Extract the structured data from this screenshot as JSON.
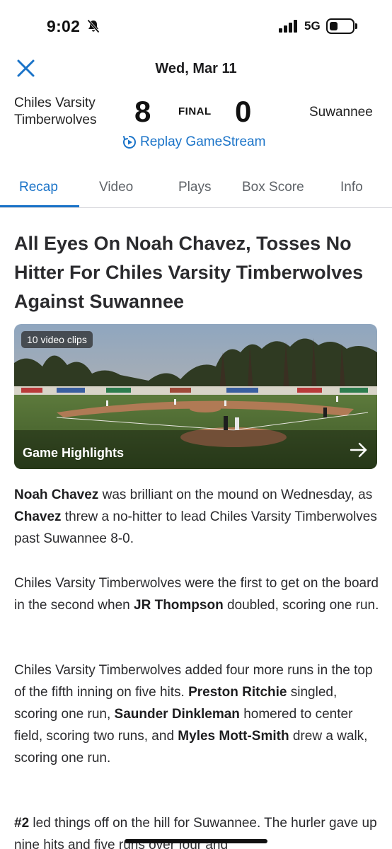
{
  "status_bar": {
    "time": "9:02",
    "network": "5G",
    "icons": [
      "bell-slash-icon",
      "signal-icon",
      "battery-icon"
    ]
  },
  "header": {
    "date": "Wed, Mar 11",
    "close_icon": "close-icon"
  },
  "scoreboard": {
    "home_team_line1": "Chiles Varsity",
    "home_team_line2": "Timberwolves",
    "home_score": "8",
    "status": "FINAL",
    "away_score": "0",
    "away_team": "Suwannee",
    "replay_label": "Replay GameStream"
  },
  "tabs": [
    {
      "label": "Recap",
      "active": true
    },
    {
      "label": "Video",
      "active": false
    },
    {
      "label": "Plays",
      "active": false
    },
    {
      "label": "Box Score",
      "active": false
    },
    {
      "label": "Info",
      "active": false
    }
  ],
  "article": {
    "headline": "All Eyes On Noah Chavez, Tosses No Hitter For Chiles Varsity Timberwolves Against Suwannee",
    "video": {
      "badge": "10 video clips",
      "title": "Game Highlights"
    },
    "paragraphs": [
      {
        "p1_a": "Noah Chavez",
        "p1_b": " was brilliant on the mound on Wednesday, as ",
        "p1_c": "Chavez",
        "p1_d": " threw a no-hitter to lead Chiles Varsity Timberwolves past Suwannee 8-0."
      },
      {
        "p2_a": "Chiles Varsity Timberwolves were the first to get on the board in the second when ",
        "p2_b": "JR Thompson",
        "p2_c": " doubled, scoring one run."
      },
      {
        "p3_a": "Chiles Varsity Timberwolves added four more runs in the top of the fifth inning on five hits. ",
        "p3_b": "Preston Ritchie",
        "p3_c": " singled, scoring one run, ",
        "p3_d": "Saunder Dinkleman",
        "p3_e": " homered to center field, scoring two runs, and ",
        "p3_f": "Myles Mott-Smith",
        "p3_g": " drew a walk, scoring one run."
      },
      {
        "p4_a": "#2",
        "p4_b": " led things off on the hill for Suwannee. The hurler gave up nine hits and five runs over four and"
      }
    ]
  },
  "colors": {
    "accent": "#1a73c8",
    "text": "#2b2b2e",
    "divider": "#d9d9de"
  }
}
